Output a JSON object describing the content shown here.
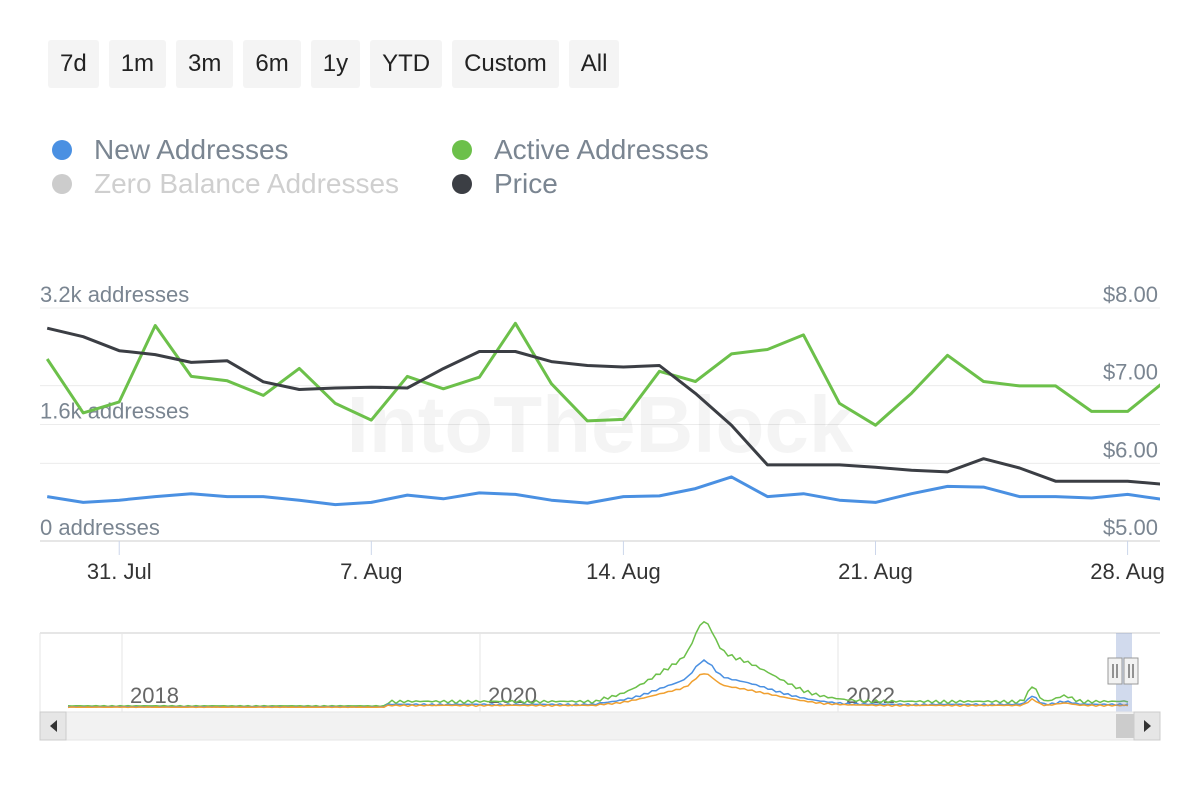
{
  "range_buttons": [
    "7d",
    "1m",
    "3m",
    "6m",
    "1y",
    "YTD",
    "Custom",
    "All"
  ],
  "legend": [
    {
      "label": "New Addresses",
      "color": "#4a90e2",
      "active": true
    },
    {
      "label": "Active Addresses",
      "color": "#6cc04a",
      "active": true
    },
    {
      "label": "Zero Balance Addresses",
      "color": "#cccccc",
      "active": false
    },
    {
      "label": "Price",
      "color": "#3b3e44",
      "active": true
    }
  ],
  "watermark": "IntoTheBlock",
  "chart_data": {
    "type": "line",
    "title": "",
    "x_tick_labels": [
      "31. Jul",
      "7. Aug",
      "14. Aug",
      "21. Aug",
      "28. Aug"
    ],
    "x_tick_days": [
      2,
      9,
      16,
      23,
      30
    ],
    "x_range_days": [
      -0.2,
      30.9
    ],
    "left_axis": {
      "labels": [
        "3.2k addresses",
        "1.6k addresses",
        "0 addresses"
      ],
      "values": [
        3200,
        1600,
        0
      ],
      "ylim": [
        0,
        3200
      ]
    },
    "right_axis": {
      "labels": [
        "$8.00",
        "$7.00",
        "$6.00",
        "$5.00"
      ],
      "values": [
        8,
        7,
        6,
        5
      ],
      "ylim": [
        5,
        8
      ]
    },
    "x_days": [
      0,
      1,
      2,
      3,
      4,
      5,
      6,
      7,
      8,
      9,
      10,
      11,
      12,
      13,
      14,
      15,
      16,
      17,
      18,
      19,
      20,
      21,
      22,
      23,
      24,
      25,
      26,
      27,
      28,
      29,
      30,
      31
    ],
    "series": [
      {
        "name": "New Addresses",
        "axis": "left",
        "color": "#4a90e2",
        "values": [
          610,
          530,
          560,
          610,
          650,
          610,
          610,
          560,
          500,
          530,
          630,
          580,
          660,
          640,
          560,
          520,
          610,
          620,
          720,
          880,
          610,
          650,
          560,
          530,
          650,
          750,
          740,
          610,
          610,
          590,
          640,
          570
        ]
      },
      {
        "name": "Active Addresses",
        "axis": "left",
        "color": "#6cc04a",
        "values": [
          2500,
          1760,
          1910,
          2960,
          2260,
          2200,
          2000,
          2370,
          1890,
          1660,
          2260,
          2090,
          2250,
          2990,
          2160,
          1650,
          1670,
          2330,
          2190,
          2570,
          2630,
          2830,
          1890,
          1590,
          2030,
          2550,
          2190,
          2130,
          2130,
          1780,
          1780,
          2180,
          2210
        ]
      },
      {
        "name": "Price",
        "axis": "right",
        "color": "#3b3e44",
        "values": [
          7.74,
          7.63,
          7.45,
          7.4,
          7.3,
          7.32,
          7.05,
          6.95,
          6.97,
          6.98,
          6.97,
          7.22,
          7.44,
          7.44,
          7.31,
          7.26,
          7.24,
          7.26,
          6.9,
          6.49,
          5.98,
          5.98,
          5.98,
          5.95,
          5.91,
          5.89,
          6.06,
          5.94,
          5.77,
          5.77,
          5.77,
          5.73,
          5.83
        ]
      }
    ],
    "navigator": {
      "x_labels": [
        "2018",
        "2020",
        "2022"
      ],
      "series_colors": [
        "#6cc04a",
        "#4a90e2",
        "#f0a030"
      ]
    },
    "grid": true
  }
}
